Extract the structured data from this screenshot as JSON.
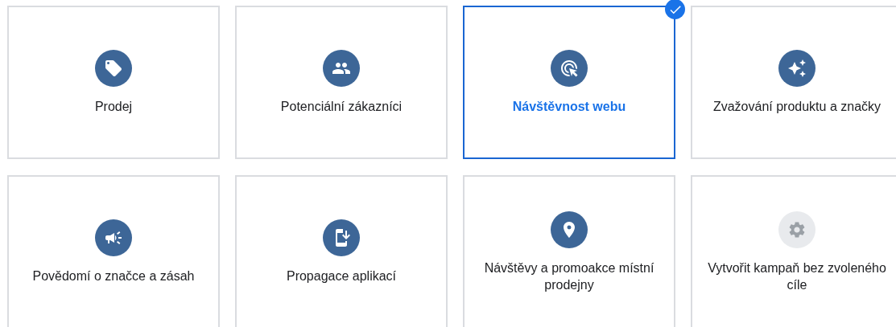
{
  "goals": [
    {
      "label": "Prodej",
      "kind": "tag",
      "selected": false
    },
    {
      "label": "Potenciální zákazníci",
      "kind": "people",
      "selected": false
    },
    {
      "label": "Návštěvnost webu",
      "kind": "click",
      "selected": true
    },
    {
      "label": "Zvažování produktu a značky",
      "kind": "sparkle",
      "selected": false
    },
    {
      "label": "Povědomí o značce a zásah",
      "kind": "megaphone",
      "selected": false
    },
    {
      "label": "Propagace aplikací",
      "kind": "phone",
      "selected": false
    },
    {
      "label": "Návštěvy a promoakce místní prodejny",
      "kind": "pin",
      "selected": false
    },
    {
      "label": "Vytvořit kampaň bez zvoleného cíle",
      "kind": "gear",
      "selected": false
    }
  ]
}
